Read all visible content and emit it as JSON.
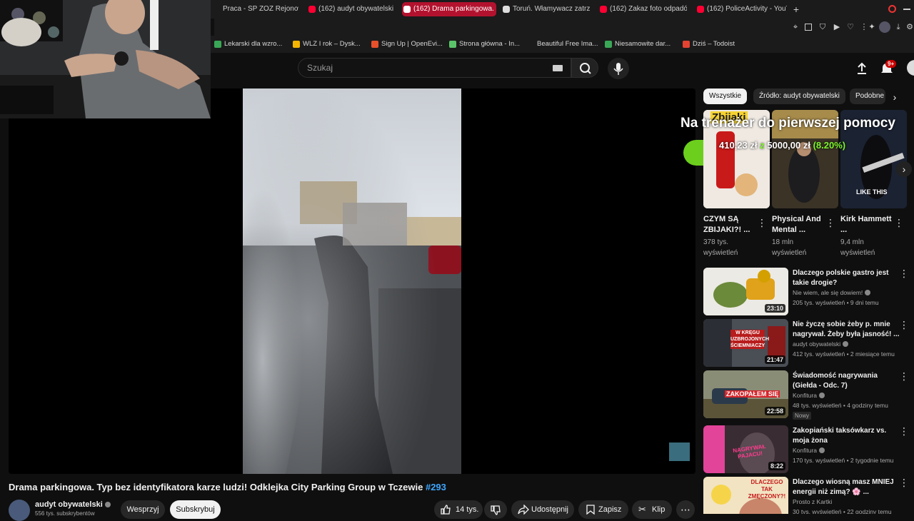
{
  "browser": {
    "tabs": [
      {
        "label": "Praca - SP ZOZ Rejonowe",
        "active": false
      },
      {
        "label": "(162) audyt obywatelski -",
        "active": false
      },
      {
        "label": "(162) Drama parkingowa.",
        "active": true
      },
      {
        "label": "Toruń. Włamywacz zatrzy",
        "active": false
      },
      {
        "label": "(162) Zakaz foto odpadów",
        "active": false
      },
      {
        "label": "(162) PoliceActivity - YouT",
        "active": false
      }
    ],
    "new_tab": "+",
    "bookmarks": [
      {
        "label": "Lekarski dla wzro...",
        "color": "#3aa757"
      },
      {
        "label": "WLZ I rok – Dysk...",
        "color": "#f4b400"
      },
      {
        "label": "Sign Up | OpenEvi...",
        "color": "#e8502b"
      },
      {
        "label": "Strona główna - In...",
        "color": "#5bc46a"
      },
      {
        "label": "Beautiful Free Ima...",
        "color": "#1b1b1b"
      },
      {
        "label": "Niesamowite dar...",
        "color": "#3aa757"
      },
      {
        "label": "Dziś – Todoist",
        "color": "#e44332"
      }
    ]
  },
  "youtube": {
    "search_placeholder": "Szukaj",
    "notifications_badge": "9+",
    "video_title": "Drama parkingowa. Typ bez identyfikatora karze ludzi! Odklejka City Parking Group w Tczewie",
    "video_hashtag": "#293",
    "channel_name": "audyt obywatelski",
    "subscribers": "556 tys. subskrybentów",
    "support_label": "Wesprzyj",
    "subscribe_label": "Subskrybuj",
    "likes": "14 tys.",
    "share_label": "Udostępnij",
    "save_label": "Zapisz",
    "clip_label": "Klip",
    "chips": [
      "Wszystkie",
      "Źródło: audyt obywatelski",
      "Podobne"
    ],
    "overlay": {
      "line1": "Na trenażer do pierwszej pomocy",
      "amount_current": "410,23 zł",
      "amount_sep": "z",
      "amount_goal": "5000,00 zł",
      "amount_percent": "(8.20%)"
    },
    "shorts": [
      {
        "title": "CZYM SĄ ZBIJAKI?! ...",
        "views": "378 tys. wyświetleń",
        "thumb_text": "Zbijaki"
      },
      {
        "title": "Physical And Mental ...",
        "views": "18 mln wyświetleń",
        "thumb_text": ""
      },
      {
        "title": "Kirk Hammett ...",
        "views": "9,4 mln wyświetleń",
        "thumb_text": "LIKE THIS"
      }
    ],
    "recommendations": [
      {
        "title": "Dlaczego polskie gastro jest takie drogie?",
        "channel": "Nie wiem, ale się dowiem!",
        "meta": "205 tys. wyświetleń • 9 dni temu",
        "duration": "23:10",
        "badge": "",
        "thumb_text": ""
      },
      {
        "title": "Nie życzę sobie żeby p. mnie nagrywał. Żeby była jasność! ...",
        "channel": "audyt obywatelski",
        "meta": "412 tys. wyświetleń • 2 miesiące temu",
        "duration": "21:47",
        "badge": "",
        "thumb_text": "W KRĘGU UZBROJONYCH ŚCIEMNIACZY"
      },
      {
        "title": "Świadomość nagrywania (Giełda - Odc. 7)",
        "channel": "Konfitura",
        "meta": "48 tys. wyświetleń • 4 godziny temu",
        "duration": "22:58",
        "badge": "Nowy",
        "thumb_text": "ZAKOPAŁEM SIĘ"
      },
      {
        "title": "Zakopiański taksówkarz vs. moja żona",
        "channel": "Konfitura",
        "meta": "170 tys. wyświetleń • 2 tygodnie temu",
        "duration": "8:22",
        "badge": "",
        "thumb_text": "NAGRYWAŁ PAJACU!"
      },
      {
        "title": "Dlaczego wiosną masz MNIEJ energii niż zimą? 🌸 ...",
        "channel": "Prosto z Kartki",
        "meta": "30 tys. wyświetleń • 22 godziny temu",
        "duration": "",
        "badge": "",
        "thumb_text": "DLACZEGO TAK ZMĘCZONY?!"
      }
    ]
  },
  "colors": {
    "accent": "#ff0033",
    "active_tab": "#b3122e",
    "link": "#3ea6ff",
    "percent_green": "#7cf52a"
  }
}
